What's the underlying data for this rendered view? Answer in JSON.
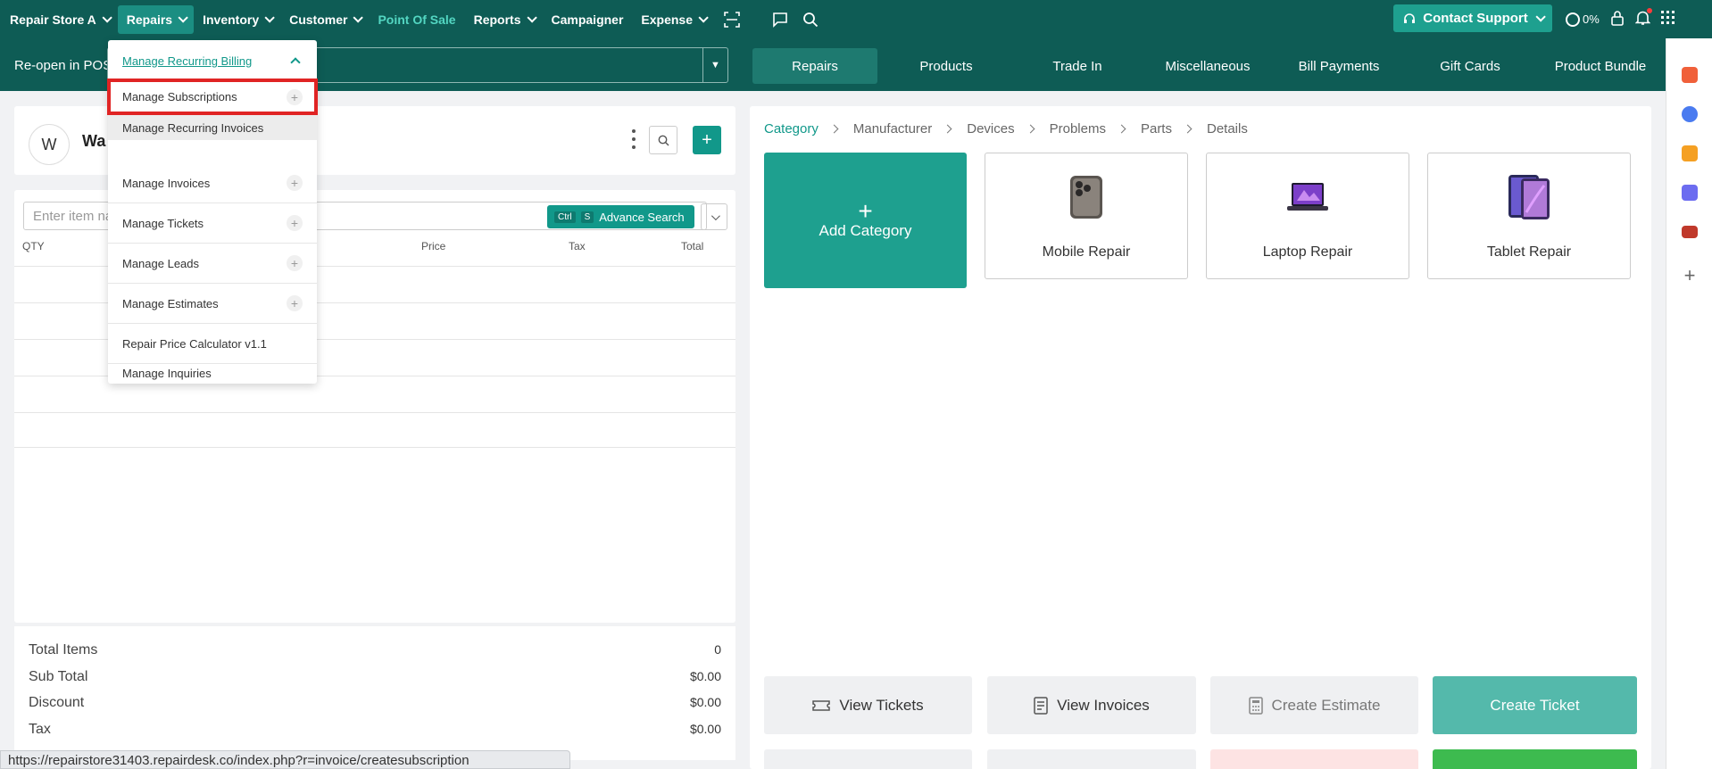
{
  "topnav": {
    "items": [
      {
        "label": "Repair Store A",
        "chevron": true
      },
      {
        "label": "Repairs",
        "chevron": true,
        "active": true
      },
      {
        "label": "Inventory",
        "chevron": true
      },
      {
        "label": "Customer",
        "chevron": true
      },
      {
        "label": "Point Of Sale",
        "chevron": false,
        "highlight": true
      },
      {
        "label": "Reports",
        "chevron": true
      },
      {
        "label": "Campaigner",
        "chevron": false
      },
      {
        "label": "Expense",
        "chevron": true
      }
    ],
    "contact_support": "Contact Support",
    "progress": "0%",
    "icons": [
      "scan-icon",
      "chat-icon",
      "search-icon",
      "headset-icon",
      "circle-progress-icon",
      "lock-icon",
      "bell-icon",
      "apps-grid-icon"
    ]
  },
  "subbar": {
    "reopen_label": "Re-open in POS",
    "tabs": [
      "Repairs",
      "Products",
      "Trade In",
      "Miscellaneous",
      "Bill Payments",
      "Gift Cards",
      "Product Bundle"
    ],
    "active_tab": "Repairs"
  },
  "customer": {
    "avatar_letter": "W",
    "name": "Wa"
  },
  "items": {
    "search_placeholder": "Enter item na",
    "advance_search": "Advance Search",
    "kbd1": "Ctrl",
    "kbd2": "S",
    "columns": {
      "qty": "QTY",
      "price": "Price",
      "tax": "Tax",
      "total": "Total"
    }
  },
  "totals": [
    {
      "label": "Total Items",
      "value": "0"
    },
    {
      "label": "Sub Total",
      "value": "$0.00"
    },
    {
      "label": "Discount",
      "value": "$0.00"
    },
    {
      "label": "Tax",
      "value": "$0.00"
    }
  ],
  "status_url": "https://repairstore31403.repairdesk.co/index.php?r=invoice/createsubscription",
  "breadcrumb": [
    "Category",
    "Manufacturer",
    "Devices",
    "Problems",
    "Parts",
    "Details"
  ],
  "categories": {
    "add_label": "Add Category",
    "devices": [
      "Mobile Repair",
      "Laptop Repair",
      "Tablet Repair"
    ]
  },
  "actions": {
    "view_tickets": "View Tickets",
    "view_invoices": "View Invoices",
    "create_estimate": "Create Estimate",
    "create_ticket": "Create Ticket"
  },
  "dropdown": {
    "header": "Manage Recurring Billing",
    "highlighted": "Manage Subscriptions",
    "sub_item": "Manage Recurring Invoices",
    "items": [
      {
        "label": "Manage Invoices",
        "plus": true
      },
      {
        "label": "Manage Tickets",
        "plus": true
      },
      {
        "label": "Manage Leads",
        "plus": true
      },
      {
        "label": "Manage Estimates",
        "plus": true
      },
      {
        "label": "Repair Price Calculator v1.1",
        "plus": false
      },
      {
        "label": "Manage Inquiries",
        "plus": false
      }
    ]
  },
  "colors": {
    "nav_bg": "#0e5c55",
    "accent": "#1ea08f",
    "highlight_border": "#e02424"
  }
}
